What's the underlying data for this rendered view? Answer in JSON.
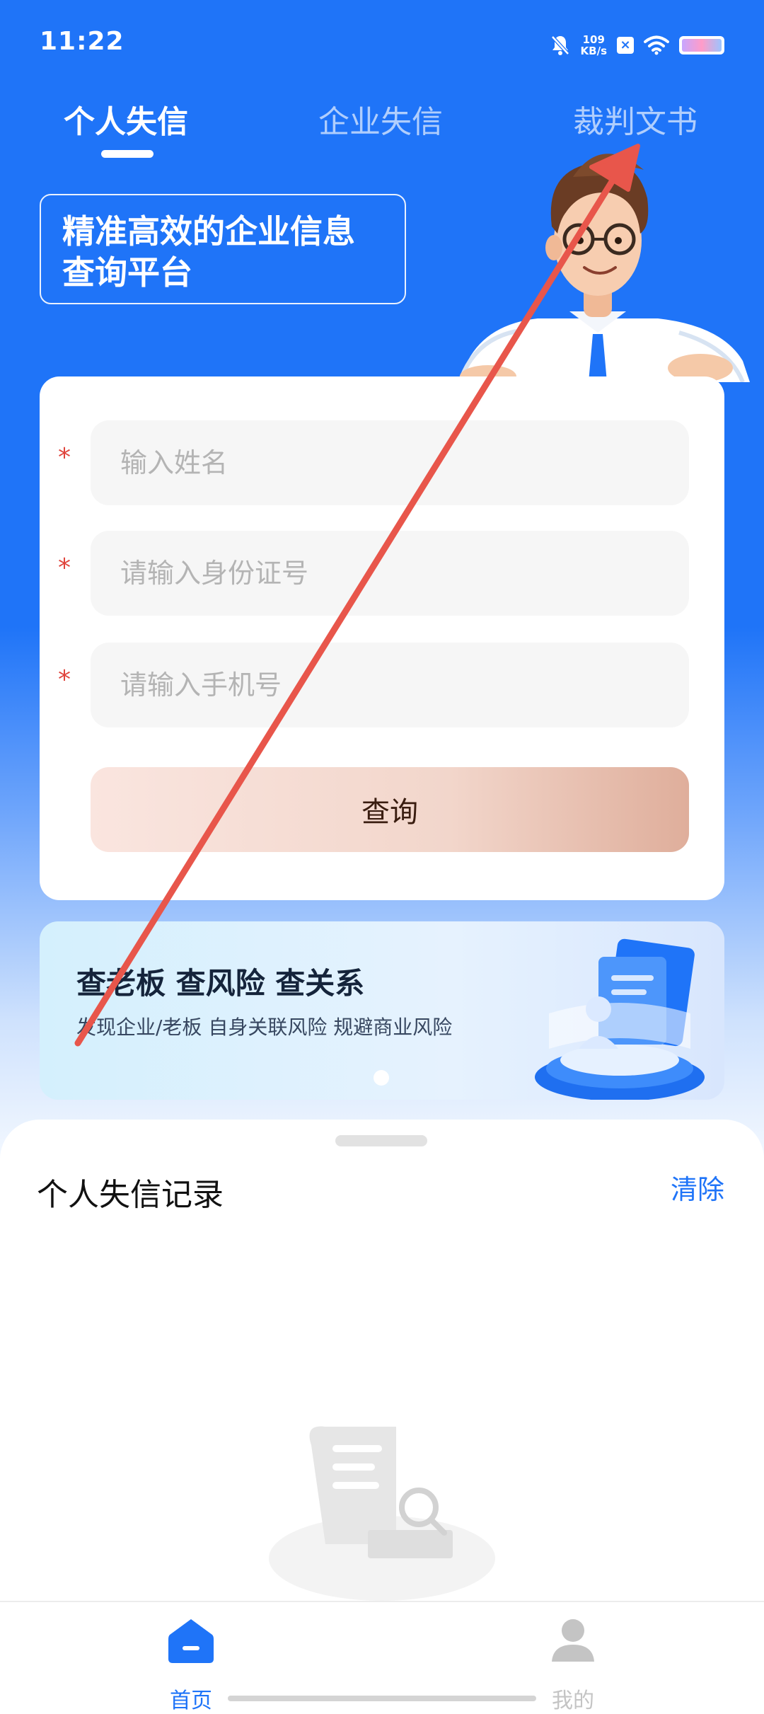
{
  "status_bar": {
    "time": "11:22",
    "net_speed_value": "109",
    "net_speed_unit": "KB/s",
    "icons": [
      "bell-muted-icon",
      "x-badge-icon",
      "wifi-icon",
      "battery-icon"
    ]
  },
  "tabs": [
    {
      "label": "个人失信",
      "active": true
    },
    {
      "label": "企业失信",
      "active": false
    },
    {
      "label": "裁判文书",
      "active": false
    }
  ],
  "hero": {
    "slogan_line1": "精准高效的企业信息",
    "slogan_line2": "查询平台"
  },
  "form": {
    "required_mark": "*",
    "name_placeholder": "输入姓名",
    "id_placeholder": "请输入身份证号",
    "phone_placeholder": "请输入手机号",
    "submit_label": "查询"
  },
  "banner": {
    "title": "查老板 查风险 查关系",
    "subtitle": "发现企业/老板  自身关联风险 规避商业风险",
    "page_count": 1,
    "current_page": 1
  },
  "records": {
    "title": "个人失信记录",
    "clear_label": "清除"
  },
  "bottom_nav": [
    {
      "label": "首页",
      "icon": "home-icon",
      "active": true
    },
    {
      "label": "我的",
      "icon": "user-icon",
      "active": false
    }
  ],
  "colors": {
    "primary": "#1f74f8",
    "required": "#e0453d",
    "gesture_arrow": "#e8564b",
    "nav_inactive": "#c4c4c4"
  }
}
